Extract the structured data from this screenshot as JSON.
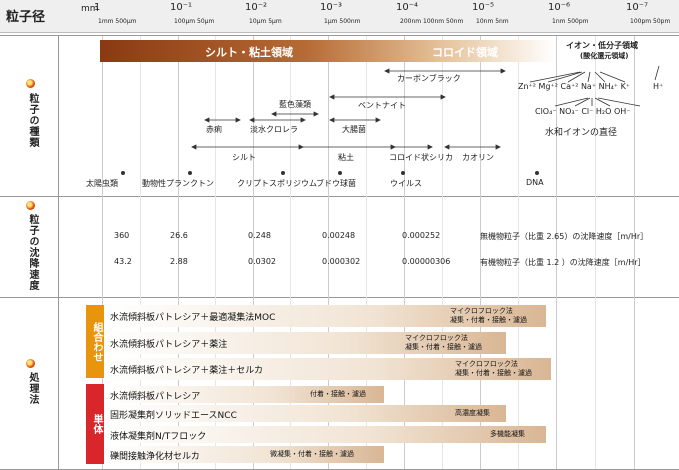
{
  "header": {
    "title": "粒子径",
    "unit": "mm",
    "scale": [
      {
        "major": "1",
        "minor": "1mm   500μm"
      },
      {
        "major": "10⁻¹",
        "minor": "100μm  50μm"
      },
      {
        "major": "10⁻²",
        "minor": "10μm  5μm"
      },
      {
        "major": "10⁻³",
        "minor": "1μm    500nm"
      },
      {
        "major": "10⁻⁴",
        "minor": "200nm 100nm  50nm"
      },
      {
        "major": "10⁻⁵",
        "minor": "10nm   5nm"
      },
      {
        "major": "10⁻⁶",
        "minor": "1nm   500pm"
      },
      {
        "major": "10⁻⁷",
        "minor": "100pm  50pm"
      }
    ]
  },
  "sections": {
    "types_label": "粒子の種類",
    "settling_label": "粒子の沈降速度",
    "treatment_label": "処理法"
  },
  "regions": {
    "silt_clay": "シルト・粘土領域",
    "colloid": "コロイド領域",
    "ion": "イオン・低分子領域",
    "ion_sub": "(酸化還元領域)"
  },
  "particles": {
    "carbon_black": "カーボンブラック",
    "bentonite": "ベントナイト",
    "blue_green_algae": "藍色藻類",
    "red_tide": "赤痢",
    "freshwater_chlorella": "淡水クロレラ",
    "e_coli": "大腸菌",
    "silt": "シルト",
    "clay": "粘土",
    "colloidal_silica": "コロイド状シリカ",
    "kaolin": "カオリン",
    "sun_worm": "太陽虫類",
    "zooplankton": "動物性プランクトン",
    "cryptosporidium": "クリプトスポリジウム",
    "staph": "ブドウ球菌",
    "virus": "ウイルス",
    "dna": "DNA",
    "hydrated_ion": "水和イオンの直径",
    "ions_row1": [
      "Zn⁺²",
      "Mg⁺²",
      "Ca⁺²",
      "Na⁺",
      "NH₄⁺",
      "K⁺",
      "H⁺"
    ],
    "ions_row2": [
      "ClO₄⁻",
      "NO₃⁻",
      "Cl⁻",
      "H₂O",
      "OH⁻"
    ]
  },
  "settling": {
    "inorganic": [
      "360",
      "26.6",
      "0.248",
      "0.00248",
      "0.000252"
    ],
    "inorganic_note": "無機物粒子（比重 2.65）の沈降速度［m/Hr］",
    "organic": [
      "43.2",
      "2.88",
      "0.0302",
      "0.000302",
      "0.00000306"
    ],
    "organic_note": "有機物粒子（比重 1.2 ）の沈降速度［m/Hr］"
  },
  "treatment": {
    "combo_tag": "組合わせ",
    "single_tag": "単体",
    "combo": [
      {
        "label": "水流傾斜板パトレシア＋最適凝集法MOC",
        "note1": "マイクロフロック法",
        "note2": "凝集・付着・接触・濾過"
      },
      {
        "label": "水流傾斜板パトレシア＋薬注",
        "note1": "マイクロフロック法",
        "note2": "凝集・付着・接触・濾過"
      },
      {
        "label": "水流傾斜板パトレシア＋薬注＋セルカ",
        "note1": "マイクロフロック法",
        "note2": "凝集・付着・接触・濾過"
      }
    ],
    "single": [
      {
        "label": "水流傾斜板パトレシア",
        "note1": "付着・接触・濾過"
      },
      {
        "label": "固形凝集剤ソリッドエースNCC",
        "note1": "高濃度凝集"
      },
      {
        "label": "液体凝集剤N/Tフロック",
        "note1": "多機能凝集"
      },
      {
        "label": "礫間接触浄化材セルカ",
        "note1": "微凝集・付着・接触・濾過"
      }
    ]
  }
}
